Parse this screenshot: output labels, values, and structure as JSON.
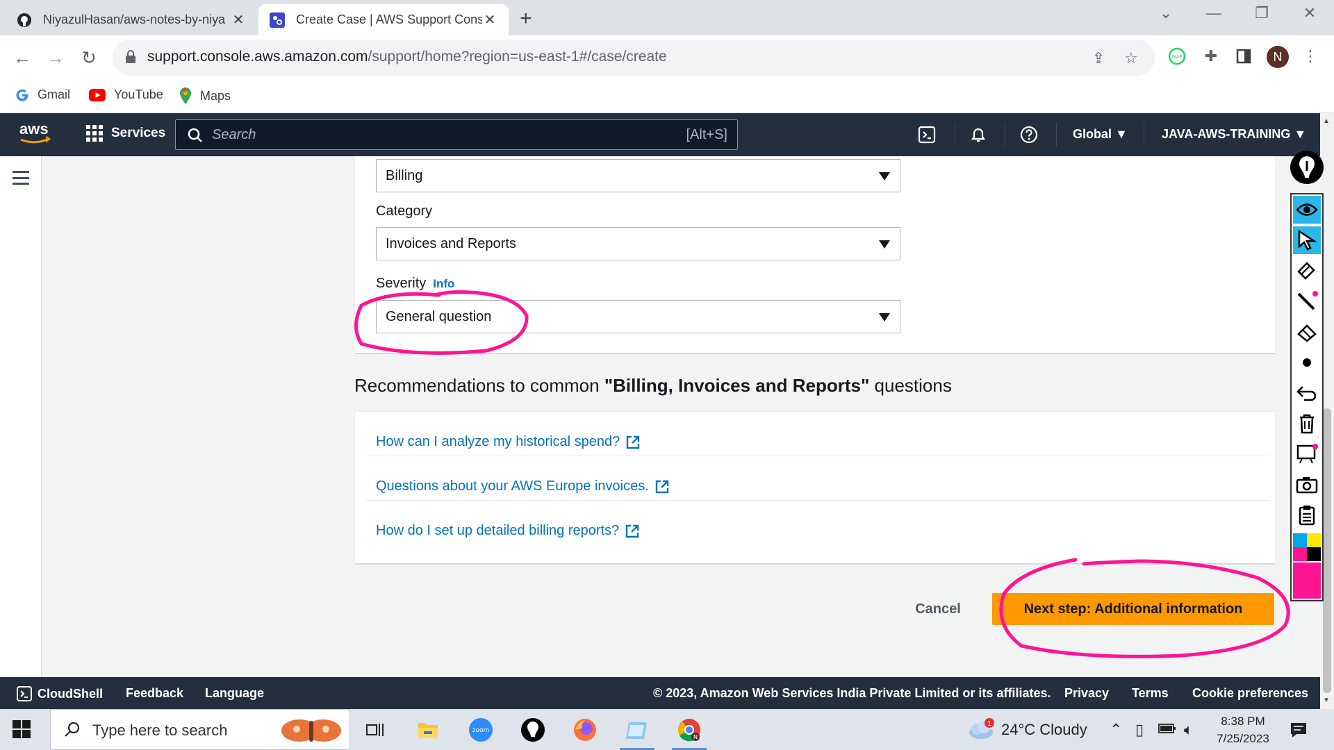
{
  "browser": {
    "tabs": [
      {
        "title": "NiyazulHasan/aws-notes-by-niya",
        "active": false,
        "icon": "github-icon"
      },
      {
        "title": "Create Case | AWS Support Cons",
        "active": true,
        "icon": "aws-support-icon"
      }
    ],
    "url_host": "support.console.aws.amazon.com",
    "url_path": "/support/home?region=us-east-1#/case/create",
    "profile_initial": "N",
    "bookmarks": [
      {
        "label": "Gmail",
        "icon": "google-icon"
      },
      {
        "label": "YouTube",
        "icon": "youtube-icon"
      },
      {
        "label": "Maps",
        "icon": "maps-icon"
      }
    ]
  },
  "aws_nav": {
    "services_label": "Services",
    "search_placeholder": "Search",
    "search_shortcut": "[Alt+S]",
    "region_label": "Global",
    "account_label": "JAVA-AWS-TRAINING"
  },
  "form": {
    "service_value": "Billing",
    "category_label": "Category",
    "category_value": "Invoices and Reports",
    "severity_label": "Severity",
    "severity_info": "Info",
    "severity_value": "General question"
  },
  "recommendations": {
    "heading_prefix": "Recommendations to common ",
    "heading_bold": "\"Billing, Invoices and Reports\"",
    "heading_suffix": " questions",
    "links": [
      "How can I analyze my historical spend?",
      "Questions about your AWS Europe invoices.",
      "How do I set up detailed billing reports?"
    ]
  },
  "actions": {
    "cancel_label": "Cancel",
    "next_label": "Next step: Additional information"
  },
  "footer": {
    "cloudshell": "CloudShell",
    "feedback": "Feedback",
    "language": "Language",
    "copyright": "© 2023, Amazon Web Services India Private Limited or its affiliates.",
    "privacy": "Privacy",
    "terms": "Terms",
    "cookies": "Cookie preferences"
  },
  "taskbar": {
    "search_placeholder": "Type here to search",
    "weather": "24°C  Cloudy",
    "weather_badge": "1",
    "time": "8:38 PM",
    "date": "7/25/2023",
    "zoom_label": "zoom"
  },
  "colors": {
    "aws_orange": "#ff9900",
    "aws_nav": "#232f3e",
    "link_blue": "#0073bb",
    "ink_pink": "#ff1493"
  }
}
